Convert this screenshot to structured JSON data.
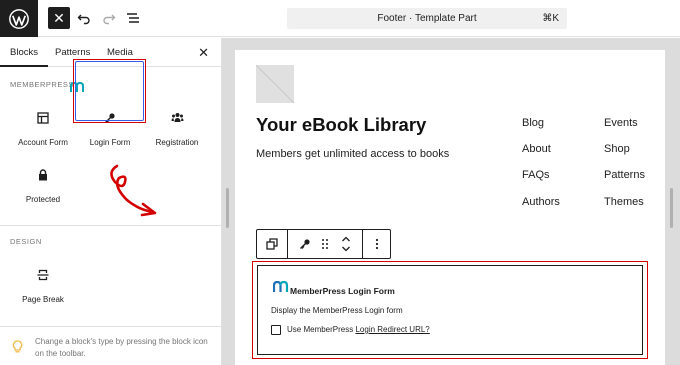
{
  "topbar": {
    "logo": "wordpress-logo",
    "close_glyph": "✕",
    "undo_icon": "undo-icon",
    "redo_icon": "redo-icon",
    "list_view_icon": "list-view-icon",
    "command_title": "Footer · Template Part",
    "command_shortcut": "⌘K"
  },
  "sidebar": {
    "tabs": [
      {
        "label": "Blocks",
        "active": true
      },
      {
        "label": "Patterns",
        "active": false
      },
      {
        "label": "Media",
        "active": false
      }
    ],
    "close_glyph": "✕",
    "memberpress_section": {
      "label": "MEMBERPRESS",
      "blocks": [
        {
          "label": "Account Form",
          "icon": "table-icon"
        },
        {
          "label": "Login Form",
          "icon": "key-icon",
          "selected": true
        },
        {
          "label": "Registration",
          "icon": "users-icon"
        },
        {
          "label": "Protected",
          "icon": "lock-icon"
        }
      ]
    },
    "design_section": {
      "label": "DESIGN",
      "blocks": [
        {
          "label": "Page Break",
          "icon": "page-break-icon"
        }
      ]
    },
    "tip": "Change a block's type by pressing the block icon on the toolbar."
  },
  "canvas": {
    "site_title": "Your eBook Library",
    "site_tagline": "Members get unlimited access to books",
    "nav_col1": [
      "Blog",
      "About",
      "FAQs",
      "Authors"
    ],
    "nav_col2": [
      "Events",
      "Shop",
      "Patterns",
      "Themes"
    ],
    "block_toolbar": {
      "transform_icon": "transform-icon",
      "key_icon": "key-icon",
      "drag_icon": "drag-handle-icon",
      "move_icon": "move-updown-icon",
      "options_icon": "more-vertical-icon"
    },
    "memberpress_block": {
      "title": "MemberPress Login Form",
      "description": "Display the MemberPress Login form",
      "checkbox_label": "Use MemberPress",
      "checkbox_link": "Login Redirect URL?",
      "checked": false
    }
  },
  "colors": {
    "highlight_red": "#d40000",
    "selection_blue": "#3858e9",
    "memberpress_teal": "#06a5b7",
    "memberpress_blue": "#1e6fb9"
  }
}
